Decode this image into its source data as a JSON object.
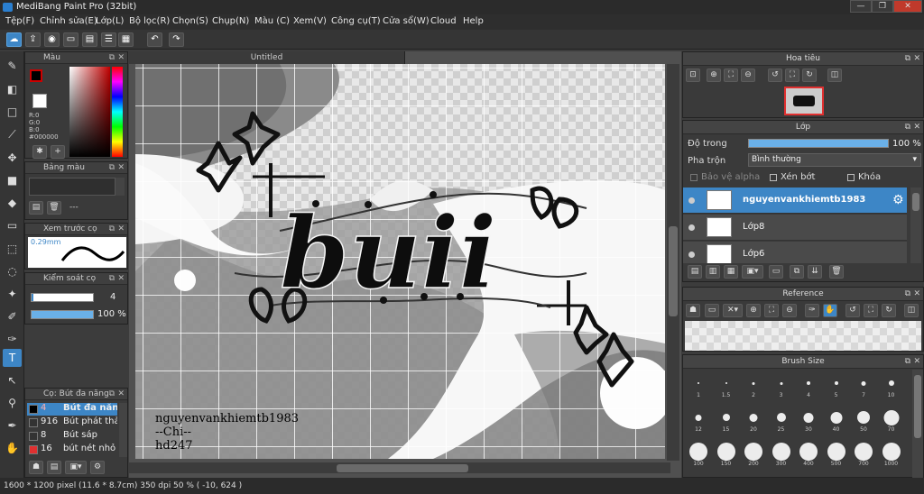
{
  "app": {
    "title": "MediBang Paint Pro (32bit)",
    "window_buttons": [
      "—",
      "❐",
      "✕"
    ]
  },
  "menu": [
    "Tệp(F)",
    "Chỉnh sửa(E)",
    "Lớp(L)",
    "Bộ lọc(R)",
    "Chọn(S)",
    "Chụp(N)",
    "Màu (C)",
    "Xem(V)",
    "Công cụ(T)",
    "Cửa sổ(W)",
    "Cloud",
    "Help"
  ],
  "toolbar": {
    "undo_label": "↶",
    "redo_label": "↷"
  },
  "color_panel": {
    "title": "Màu",
    "rgb": [
      "R:0",
      "G:0",
      "B:0"
    ],
    "hex": "#000000",
    "fg_color": "#000000",
    "bg_color": "#ffffff"
  },
  "palette_panel": {
    "title": "Bảng màu",
    "value": "---"
  },
  "brush_preview_panel": {
    "title": "Xem trước cọ",
    "size": "0.29mm"
  },
  "brush_control_panel": {
    "title": "Kiểm soát cọ",
    "size_value": "4",
    "opacity_value": "100 %"
  },
  "brush_list_panel": {
    "title": "Cọ: Bút đa năng",
    "items": [
      {
        "num": "4",
        "name": "Bút đa năng",
        "color": "#000000",
        "selected": true
      },
      {
        "num": "916",
        "name": "Bút phát thảo",
        "color": "#333333",
        "selected": false
      },
      {
        "num": "8",
        "name": "Bút sáp",
        "color": "#333333",
        "selected": false
      },
      {
        "num": "16",
        "name": "bút nét nhỏ",
        "color": "#e03030",
        "selected": false
      }
    ]
  },
  "canvas": {
    "tab_title": "Untitled",
    "watermark_lines": [
      "nguyenvankhiemtb1983",
      "--Chi--",
      "hd247"
    ],
    "title_art_text": "buii"
  },
  "navigator_panel": {
    "title": "Hoa tiêu"
  },
  "layer_panel": {
    "title": "Lớp",
    "opacity_label": "Độ trong",
    "opacity_value": "100 %",
    "blend_label": "Pha trộn",
    "blend_value": "Bình thường",
    "protect_alpha": "Bảo vệ alpha",
    "clipping": "Xén bớt",
    "lock": "Khóa",
    "layers": [
      {
        "name": "nguyenvankhiemtb1983",
        "selected": true
      },
      {
        "name": "Lớp8",
        "selected": false
      },
      {
        "name": "Lớp6",
        "selected": false
      }
    ]
  },
  "reference_panel": {
    "title": "Reference"
  },
  "brush_size_panel": {
    "title": "Brush Size",
    "sizes": [
      "1",
      "1.5",
      "2",
      "3",
      "4",
      "5",
      "7",
      "10",
      "12",
      "15",
      "20",
      "25",
      "30",
      "40",
      "50",
      "70",
      "100",
      "150",
      "200",
      "300",
      "400",
      "500",
      "700",
      "1000"
    ]
  },
  "status": {
    "text": "1600 * 1200 pixel  (11.6 * 8.7cm)  350 dpi  50 %  ( -10, 624 )"
  },
  "colors": {
    "accent": "#3d86c6",
    "panel_bg": "#3a3a3a",
    "app_bg": "#3c3c3c"
  }
}
